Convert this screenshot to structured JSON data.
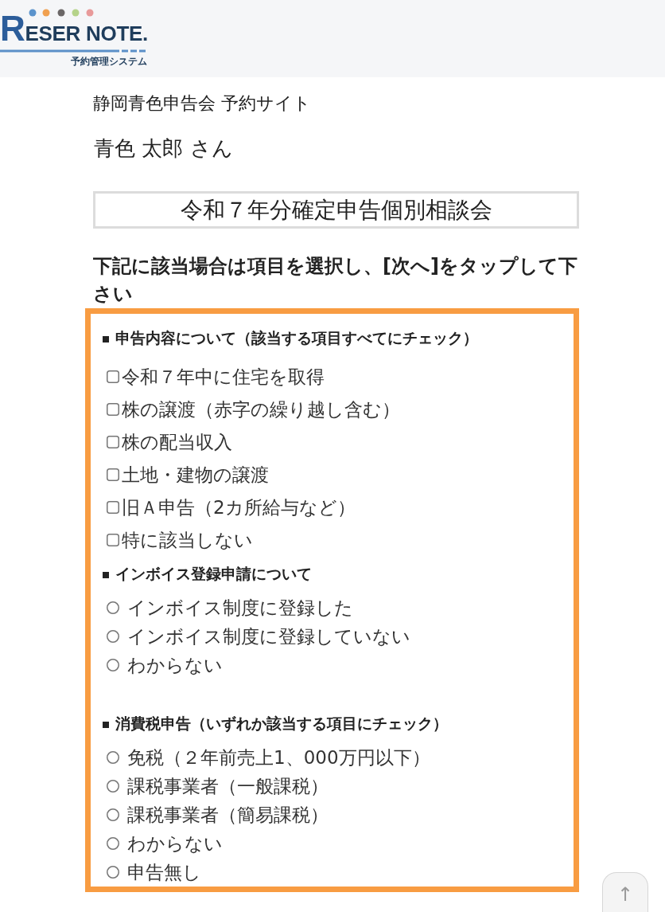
{
  "header": {
    "logo": {
      "wordmark": "RESER NOTE.",
      "tagline": "予約管理システム"
    }
  },
  "site_title": "静岡青色申告会 予約サイト",
  "user_greeting": "青色 太郎 さん",
  "event_title": "令和７年分確定申告個別相談会",
  "instruction": "下記に該当場合は項目を選択し、[次へ]をタップして下さい",
  "form": {
    "sections": [
      {
        "kind": "checkbox",
        "heading": "申告内容について（該当する項目すべてにチェック）",
        "options": [
          {
            "label": "令和７年中に住宅を取得",
            "checked": false
          },
          {
            "label": "株の譲渡（赤字の繰り越し含む）",
            "checked": false
          },
          {
            "label": "株の配当収入",
            "checked": false
          },
          {
            "label": "土地・建物の譲渡",
            "checked": false
          },
          {
            "label": "旧Ａ申告（2カ所給与など）",
            "checked": false
          },
          {
            "label": "特に該当しない",
            "checked": false
          }
        ]
      },
      {
        "kind": "radio",
        "heading": "インボイス登録申請について",
        "options": [
          {
            "label": "インボイス制度に登録した",
            "selected": false
          },
          {
            "label": "インボイス制度に登録していない",
            "selected": false
          },
          {
            "label": "わからない",
            "selected": false
          }
        ]
      },
      {
        "kind": "radio",
        "heading": "消費税申告（いずれか該当する項目にチェック）",
        "options": [
          {
            "label": "免税（２年前売上1、000万円以下）",
            "selected": false
          },
          {
            "label": "課税事業者（一般課税）",
            "selected": false
          },
          {
            "label": "課税事業者（簡易課税）",
            "selected": false
          },
          {
            "label": "わからない",
            "selected": false
          },
          {
            "label": "申告無し",
            "selected": false
          }
        ]
      }
    ]
  },
  "scroll_top_button": {
    "label": "↑"
  }
}
